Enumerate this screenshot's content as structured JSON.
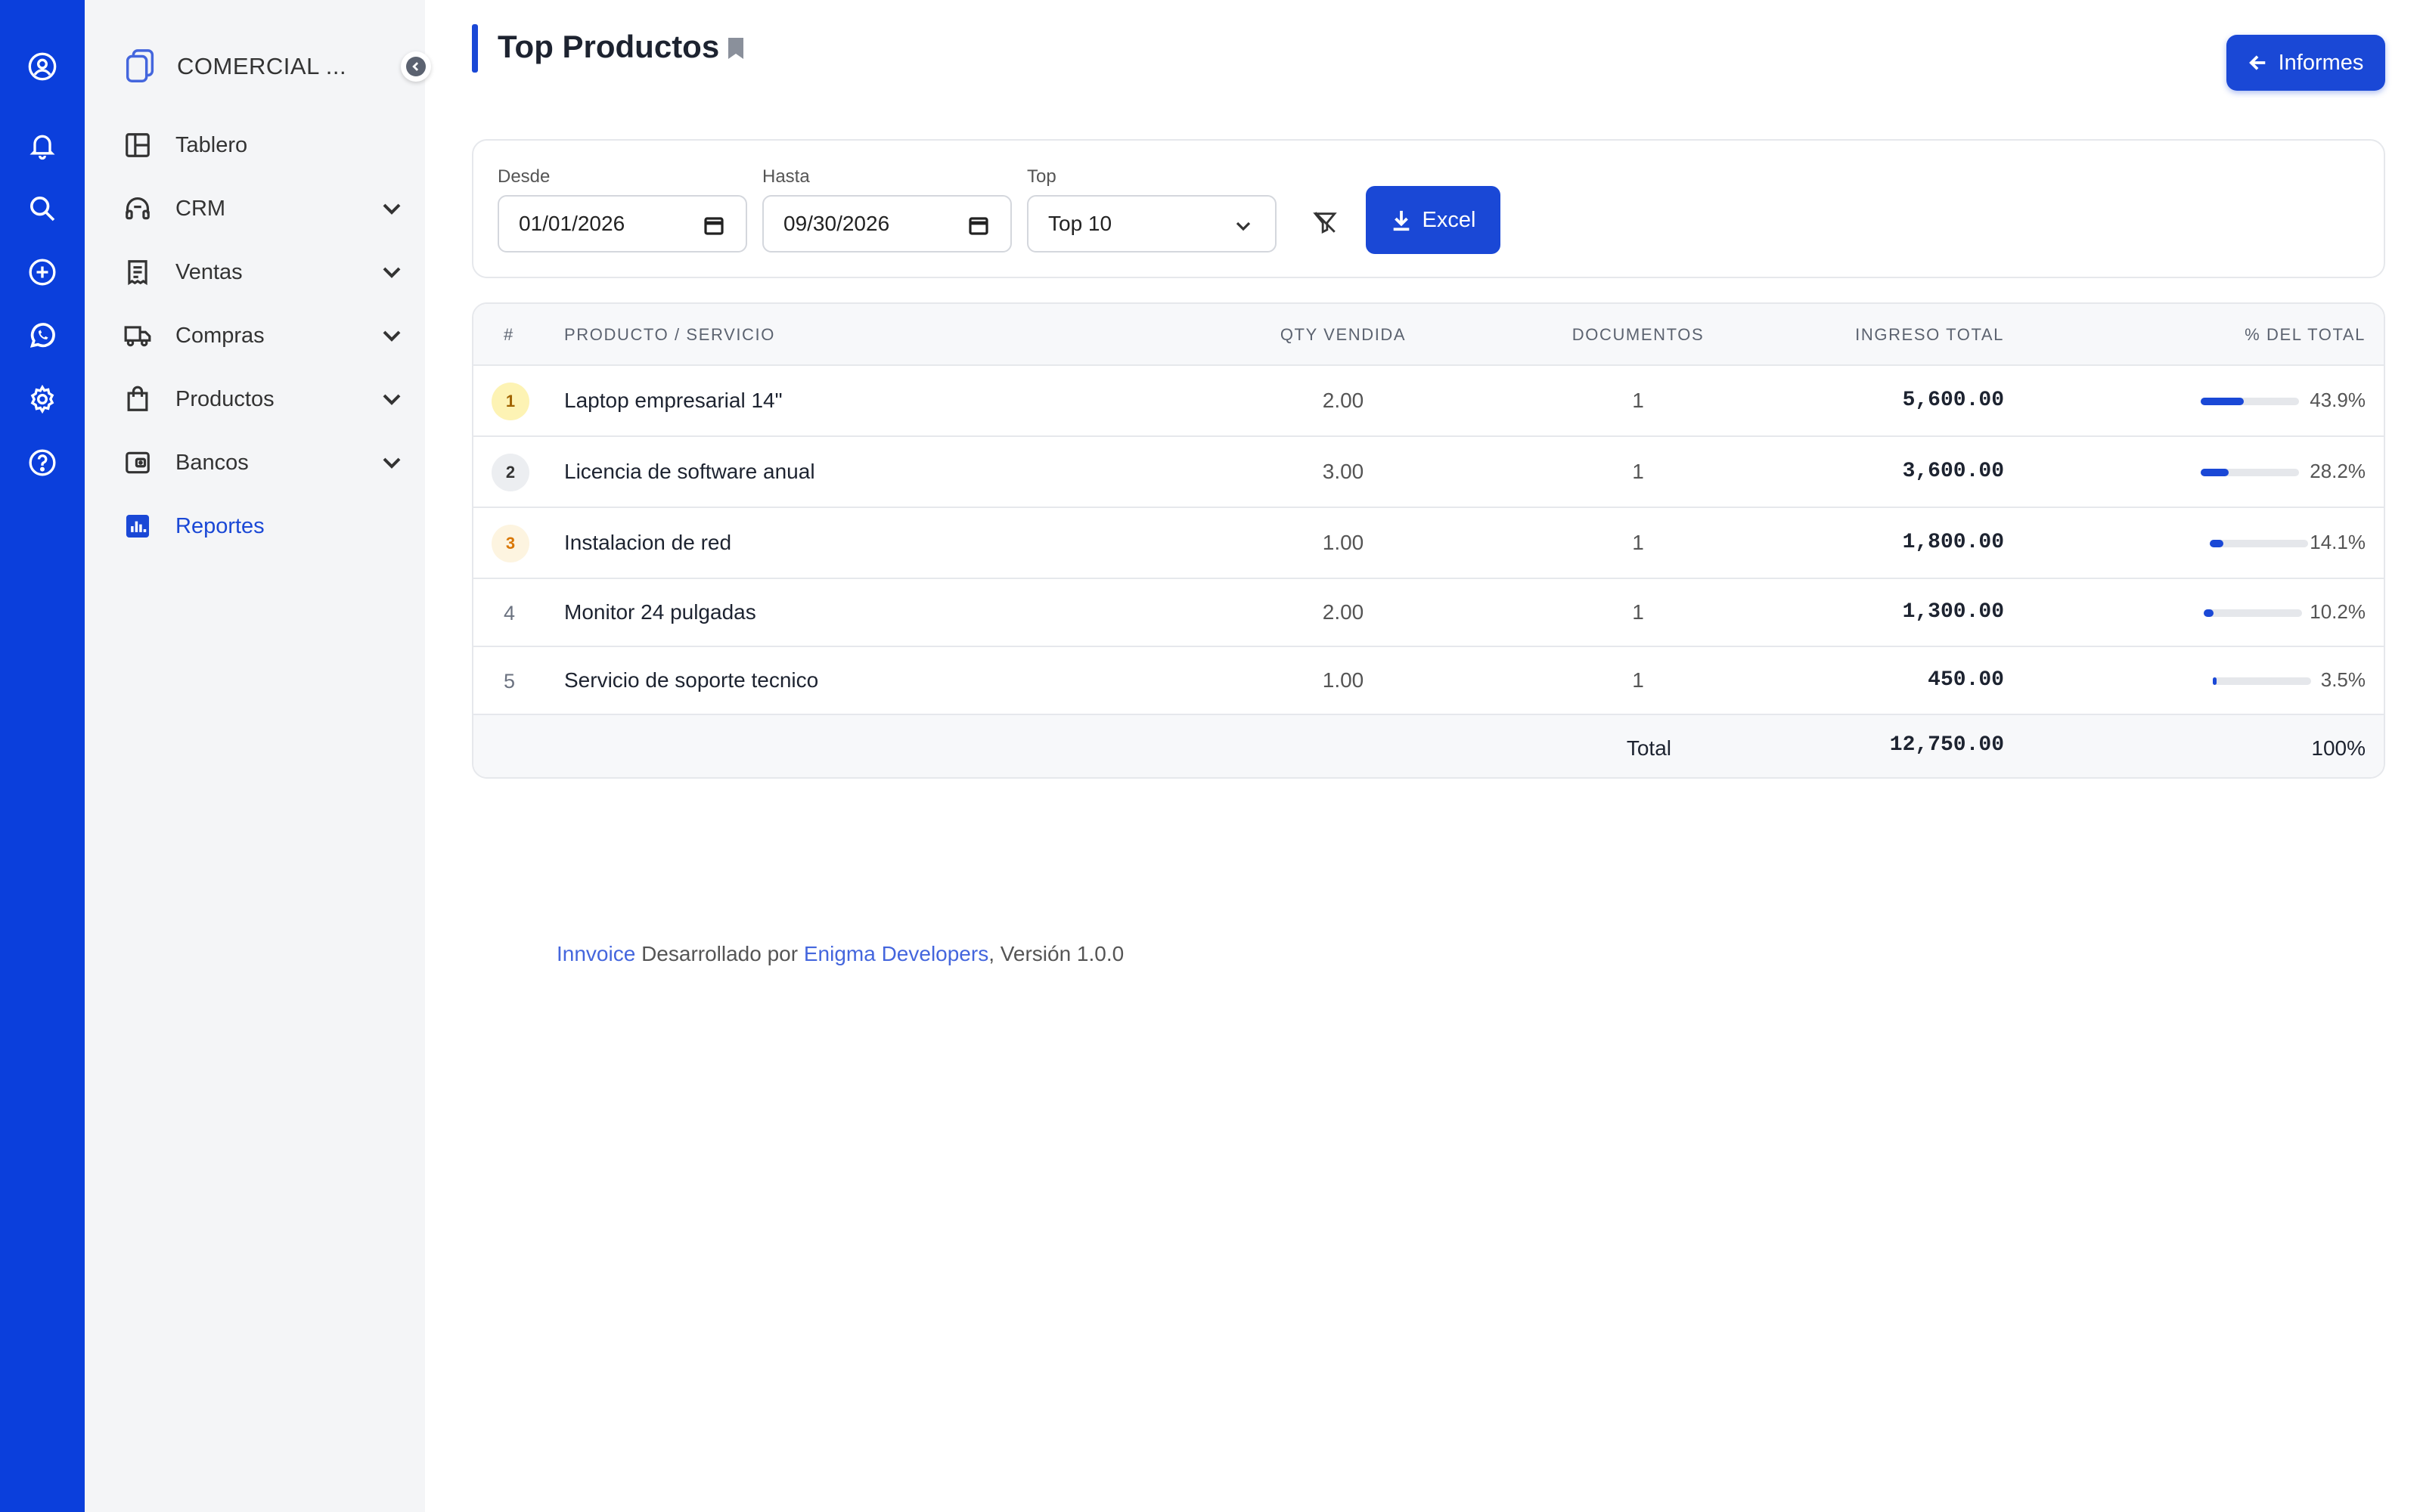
{
  "sidebar": {
    "company": "COMERCIAL ...",
    "items": [
      {
        "label": "Tablero",
        "icon": "dashboard-icon",
        "chevron": false
      },
      {
        "label": "CRM",
        "icon": "headset-icon",
        "chevron": true
      },
      {
        "label": "Ventas",
        "icon": "receipt-icon",
        "chevron": true
      },
      {
        "label": "Compras",
        "icon": "truck-icon",
        "chevron": true
      },
      {
        "label": "Productos",
        "icon": "shopping-bag-icon",
        "chevron": true
      },
      {
        "label": "Bancos",
        "icon": "wallet-icon",
        "chevron": true
      },
      {
        "label": "Reportes",
        "icon": "bar-chart-icon",
        "chevron": false,
        "active": true
      }
    ]
  },
  "header": {
    "title": "Top Productos",
    "back_button": "Informes"
  },
  "filters": {
    "desde_label": "Desde",
    "desde_value": "01/01/2026",
    "hasta_label": "Hasta",
    "hasta_value": "09/30/2026",
    "top_label": "Top",
    "top_value": "Top 10",
    "excel_label": "Excel"
  },
  "table": {
    "columns": [
      "#",
      "PRODUCTO / SERVICIO",
      "QTY VENDIDA",
      "DOCUMENTOS",
      "INGRESO TOTAL",
      "% DEL TOTAL"
    ],
    "rows": [
      {
        "rank": "1",
        "product": "Laptop empresarial 14\"",
        "qty": "2.00",
        "docs": "1",
        "ingreso": "5,600.00",
        "pct": "43.9%",
        "pct_value": 43.9
      },
      {
        "rank": "2",
        "product": "Licencia de software anual",
        "qty": "3.00",
        "docs": "1",
        "ingreso": "3,600.00",
        "pct": "28.2%",
        "pct_value": 28.2
      },
      {
        "rank": "3",
        "product": "Instalacion de red",
        "qty": "1.00",
        "docs": "1",
        "ingreso": "1,800.00",
        "pct": "14.1%",
        "pct_value": 14.1
      },
      {
        "rank": "4",
        "product": "Monitor 24 pulgadas",
        "qty": "2.00",
        "docs": "1",
        "ingreso": "1,300.00",
        "pct": "10.2%",
        "pct_value": 10.2
      },
      {
        "rank": "5",
        "product": "Servicio de soporte tecnico",
        "qty": "1.00",
        "docs": "1",
        "ingreso": "450.00",
        "pct": "3.5%",
        "pct_value": 3.5
      }
    ],
    "total_label": "Total",
    "total_ingreso": "12,750.00",
    "total_pct": "100%"
  },
  "footer": {
    "brand": "Innvoice",
    "middle": " Desarrollado por ",
    "dev": "Enigma Developers",
    "version": ", Versión 1.0.0"
  },
  "colors": {
    "primary": "#1a48d6",
    "rail": "#0b3fdc",
    "sidebar_bg": "#f4f5f7",
    "rank1_bg": "#fdf3b4",
    "rank2_bg": "#eceef1",
    "rank3_bg": "#fdf4e0"
  }
}
